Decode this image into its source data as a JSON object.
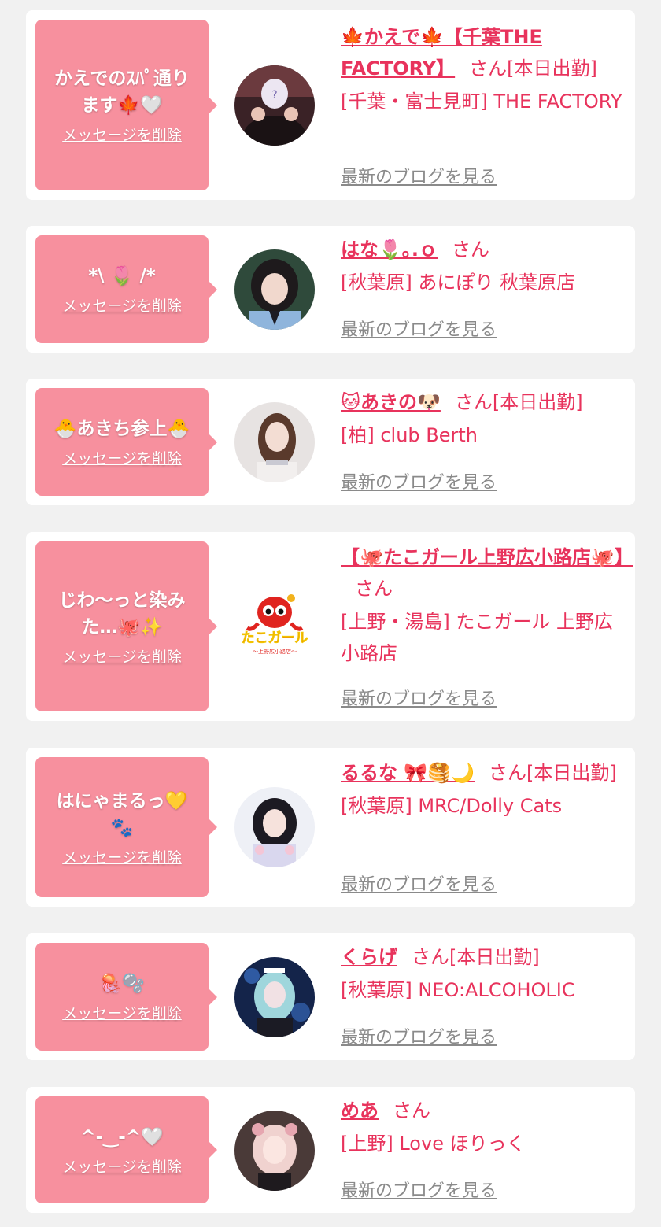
{
  "delete_label": "メッセージを削除",
  "blog_label": "最新のブログを見る",
  "honorific": "さん",
  "colors": {
    "accent": "#e8335c",
    "bubble": "#f7909e",
    "background": "#f1f1f1",
    "card": "#ffffff",
    "link_gray": "#8a8a8a"
  },
  "entries": [
    {
      "message": "かえでのｽﾊﾟ通ります🍁🤍",
      "name": "🍁かえで🍁【千葉THE FACTORY】",
      "status": "[本日出勤]",
      "shop": "[千葉・富士見町] THE FACTORY",
      "avatar_icon": "person-photo"
    },
    {
      "message": "*\\ 🌷 /*",
      "name": "はな🌷｡.ｏ",
      "status": "",
      "shop": "[秋葉原] あにぽり 秋葉原店",
      "avatar_icon": "person-photo"
    },
    {
      "message": "🐣あきち参上🐣",
      "name": "🐱あきの🐶",
      "status": "[本日出勤]",
      "shop": "[柏] club Berth",
      "avatar_icon": "person-photo"
    },
    {
      "message": "じわ〜っと染みた…🐙✨",
      "name": "【🐙たこガール上野広小路店🐙】",
      "status": "",
      "shop": "[上野・湯島] たこガール 上野広小路店",
      "avatar_icon": "octopus-logo",
      "logo_text": "たこガール",
      "logo_sub": "〜上野広小路店〜"
    },
    {
      "message": "はにゃまるっ💛🐾",
      "name": "るるな 🎀🥞🌙",
      "status": "[本日出勤]",
      "shop": "[秋葉原] MRC/Dolly Cats",
      "avatar_icon": "person-photo"
    },
    {
      "message": "🪼🫧",
      "name": "くらげ",
      "status": "[本日出勤]",
      "shop": "[秋葉原] NEO:ALCOHOLIC",
      "avatar_icon": "person-photo"
    },
    {
      "message": "^-‿-^🤍",
      "name": "めあ",
      "status": "",
      "shop": "[上野] Love ほりっく",
      "avatar_icon": "person-photo"
    }
  ]
}
